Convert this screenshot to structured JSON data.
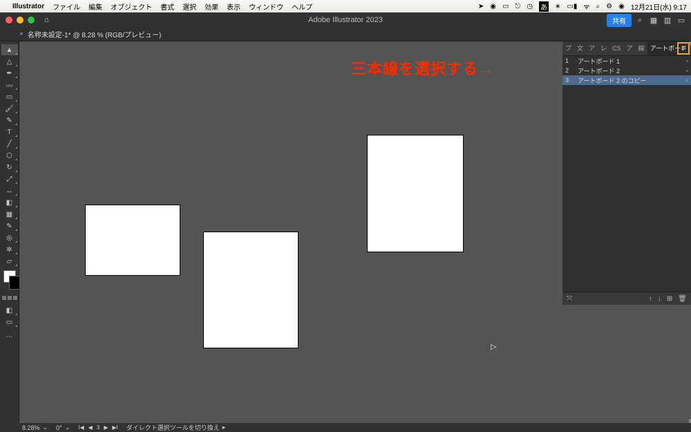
{
  "menubar": {
    "app": "Illustrator",
    "items": [
      "ファイル",
      "編集",
      "オブジェクト",
      "書式",
      "選択",
      "効果",
      "表示",
      "ウィンドウ",
      "ヘルプ"
    ],
    "clock": "12月21日(水)  9:17"
  },
  "titlebar": {
    "title": "Adobe Illustrator 2023",
    "share": "共有"
  },
  "doctab": {
    "label": "名称未設定-1* @ 8.28 % (RGB/プレビュー)"
  },
  "annotation": "三本線を選択する→",
  "panel": {
    "tabs": [
      "プ",
      "文",
      "ア",
      "レ",
      "CS",
      "ア",
      "線"
    ],
    "active": "アートボード",
    "artboards": [
      {
        "num": "1",
        "name": "アートボード 1"
      },
      {
        "num": "2",
        "name": "アートボード 2"
      },
      {
        "num": "3",
        "name": "アートボード 2 のコピー"
      }
    ]
  },
  "status": {
    "zoom": "8.28%",
    "rotate": "0°",
    "ab_current": "3",
    "hint": "ダイレクト選択ツールを切り換え"
  }
}
